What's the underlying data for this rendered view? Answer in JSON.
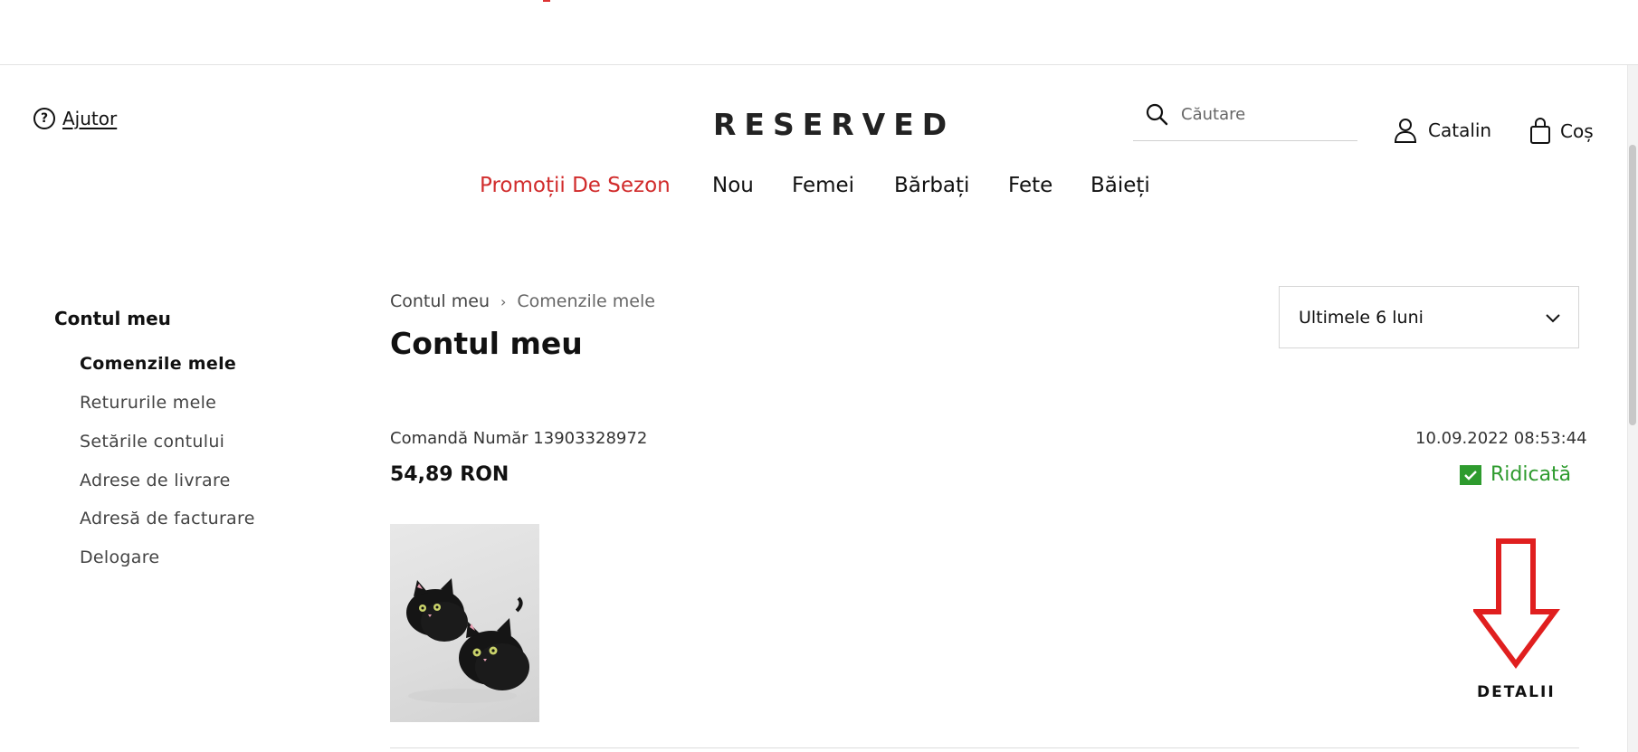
{
  "header": {
    "help_label": "Ajutor",
    "logo_text": "RESERVED",
    "search_placeholder": "Căutare",
    "user_name": "Catalin",
    "cart_label": "Coș"
  },
  "nav": {
    "items": [
      {
        "label": "Promoții De Sezon",
        "highlight": true,
        "color": "#d12c2c"
      },
      {
        "label": "Nou"
      },
      {
        "label": "Femei"
      },
      {
        "label": "Bărbați"
      },
      {
        "label": "Fete"
      },
      {
        "label": "Băieți"
      }
    ]
  },
  "sidebar": {
    "title": "Contul meu",
    "items": [
      {
        "label": "Comenzile mele",
        "active": true
      },
      {
        "label": "Retururile mele"
      },
      {
        "label": "Setările contului"
      },
      {
        "label": "Adrese de livrare"
      },
      {
        "label": "Adresă de facturare"
      },
      {
        "label": "Delogare"
      }
    ]
  },
  "breadcrumb": {
    "items": [
      "Contul meu",
      "Comenzile mele"
    ]
  },
  "main": {
    "title": "Contul meu",
    "period_selected": "Ultimele 6 luni"
  },
  "order": {
    "number_label": "Comandă Număr 13903328972",
    "total": "54,89 RON",
    "date": "10.09.2022 08:53:44",
    "status": "Ridicată",
    "status_color": "#2e9b2e",
    "details_label": "DETALII"
  },
  "colors": {
    "accent_red": "#d12c2c",
    "annotation_red": "#e01f1f",
    "status_green": "#2e9b2e"
  }
}
